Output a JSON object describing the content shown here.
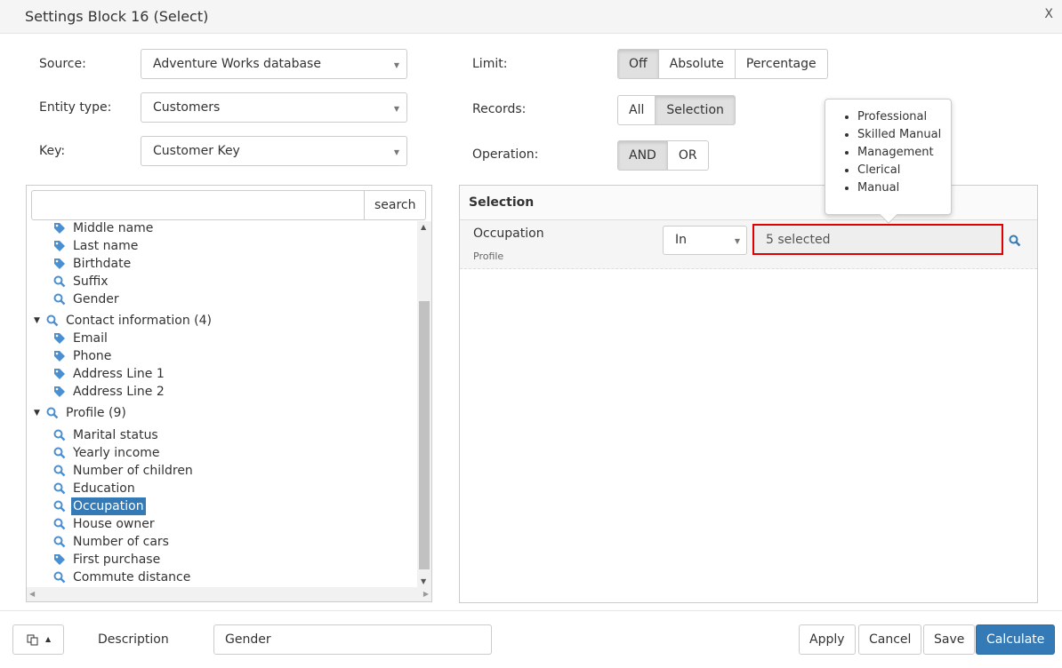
{
  "dialog": {
    "title": "Settings Block 16 (Select)",
    "close": "X"
  },
  "form": {
    "source": {
      "label": "Source:",
      "value": "Adventure Works database"
    },
    "entity_type": {
      "label": "Entity type:",
      "value": "Customers"
    },
    "key": {
      "label": "Key:",
      "value": "Customer Key"
    },
    "limit": {
      "label": "Limit:",
      "options": [
        "Off",
        "Absolute",
        "Percentage"
      ],
      "selected": "Off"
    },
    "records": {
      "label": "Records:",
      "options": [
        "All",
        "Selection"
      ],
      "selected": "Selection"
    },
    "operation": {
      "label": "Operation:",
      "options": [
        "AND",
        "OR"
      ],
      "selected": "AND"
    }
  },
  "tree": {
    "search_placeholder": "",
    "search_button": "search",
    "items": [
      {
        "label": "Middle name",
        "icon": "tag",
        "level": 1
      },
      {
        "label": "Last name",
        "icon": "tag",
        "level": 1
      },
      {
        "label": "Birthdate",
        "icon": "tag",
        "level": 1
      },
      {
        "label": "Suffix",
        "icon": "search",
        "level": 1
      },
      {
        "label": "Gender",
        "icon": "search",
        "level": 1
      },
      {
        "label": "Contact information (4)",
        "icon": "search",
        "level": 0
      },
      {
        "label": "Email",
        "icon": "tag",
        "level": 1
      },
      {
        "label": "Phone",
        "icon": "tag",
        "level": 1
      },
      {
        "label": "Address Line 1",
        "icon": "tag",
        "level": 1
      },
      {
        "label": "Address Line 2",
        "icon": "tag",
        "level": 1
      },
      {
        "label": "Profile (9)",
        "icon": "search",
        "level": 0
      },
      {
        "label": "Marital status",
        "icon": "search",
        "level": 1
      },
      {
        "label": "Yearly income",
        "icon": "search",
        "level": 1
      },
      {
        "label": "Number of children",
        "icon": "search",
        "level": 1
      },
      {
        "label": "Education",
        "icon": "search",
        "level": 1
      },
      {
        "label": "Occupation",
        "icon": "search",
        "level": 1,
        "selected": true
      },
      {
        "label": "House owner",
        "icon": "search",
        "level": 1
      },
      {
        "label": "Number of cars",
        "icon": "search",
        "level": 1
      },
      {
        "label": "First purchase",
        "icon": "tag",
        "level": 1
      },
      {
        "label": "Commute distance",
        "icon": "search",
        "level": 1
      }
    ]
  },
  "selection": {
    "title": "Selection",
    "row": {
      "field": "Occupation",
      "group": "Profile",
      "operator": "In",
      "value": "5 selected"
    },
    "tooltip": [
      "Professional",
      "Skilled Manual",
      "Management",
      "Clerical",
      "Manual"
    ]
  },
  "footer": {
    "description_label": "Description",
    "description_value": "Gender",
    "apply": "Apply",
    "cancel": "Cancel",
    "save": "Save",
    "calculate": "Calculate"
  },
  "colors": {
    "accent": "#337ab7",
    "icon": "#4a8fd1",
    "highlight": "#e00000"
  }
}
